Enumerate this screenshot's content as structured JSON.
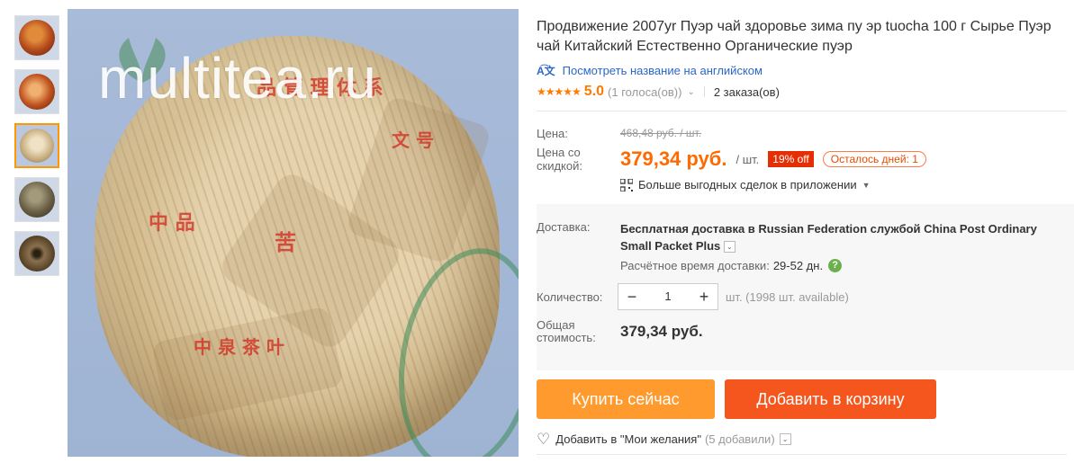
{
  "gallery": {
    "thumbnails": [
      "thumb-1",
      "thumb-2",
      "thumb-3",
      "thumb-4",
      "thumb-5"
    ],
    "active_index": 2,
    "watermark": "multitea.ru"
  },
  "product": {
    "title": "Продвижение 2007yr Пуэр чай здоровье зима пу эр tuocha 100 г Сырье Пуэр чай Китайский Естественно Органические пуэр",
    "translate_link": "Посмотреть название на английском",
    "rating_value": "5.0",
    "stars": "★★★★★",
    "votes": "(1 голоса(ов))",
    "orders": "2 заказа(ов)"
  },
  "price": {
    "label": "Цена:",
    "old_price": "468,48 руб. / шт.",
    "discount_label": "Цена со скидкой:",
    "new_price": "379,34 руб.",
    "unit": "/ шт.",
    "discount_badge": "19% off",
    "days_left": "Осталось дней: 1",
    "app_deals": "Больше выгодных сделок в приложении"
  },
  "shipping": {
    "label": "Доставка:",
    "text": "Бесплатная доставка в Russian Federation службой China Post Ordinary Small Packet Plus",
    "eta_label": "Расчётное время доставки:",
    "eta_value": "29-52 дн."
  },
  "quantity": {
    "label": "Количество:",
    "value": "1",
    "minus": "−",
    "plus": "+",
    "available": "шт. (1998 шт. available)"
  },
  "total": {
    "label": "Общая стоимость:",
    "value": "379,34 руб."
  },
  "actions": {
    "buy_now": "Купить сейчас",
    "add_to_cart": "Добавить в корзину",
    "wishlist": "Добавить в \"Мои желания\"",
    "wishlist_count": "(5 добавили)"
  },
  "colors": {
    "accent_orange": "#ff6a00",
    "buy_button": "#ff9a2e",
    "cart_button": "#f5561d",
    "link_blue": "#2a67c9",
    "badge_red": "#e62e04"
  }
}
